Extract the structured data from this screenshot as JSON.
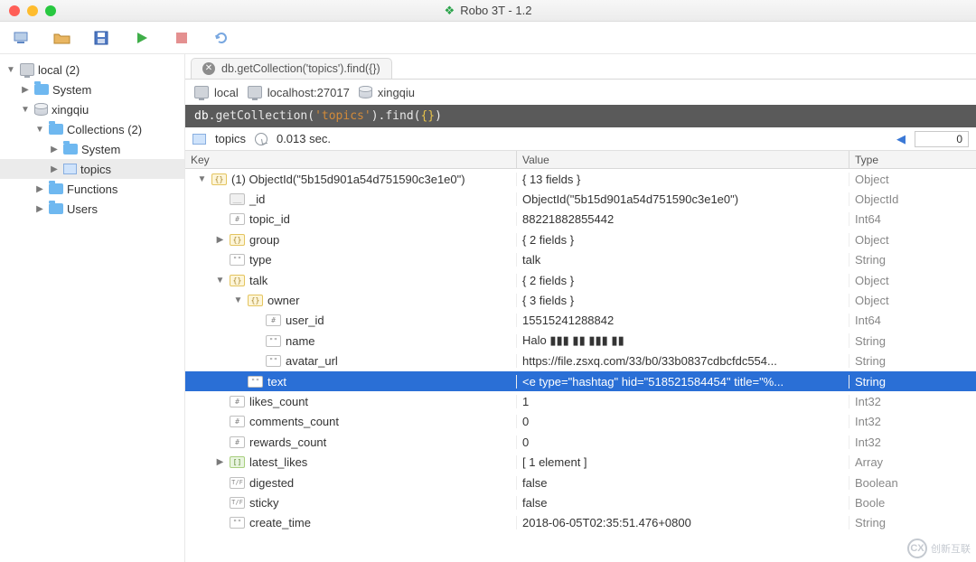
{
  "window": {
    "title": "Robo 3T - 1.2"
  },
  "toolbar_icons": [
    "connect",
    "open",
    "save",
    "run",
    "stop",
    "refresh"
  ],
  "sidebar": {
    "root": {
      "label": "local (2)",
      "expanded": true
    },
    "items": [
      {
        "label": "System",
        "expanded": false,
        "type": "folder"
      },
      {
        "label": "xingqiu",
        "expanded": true,
        "type": "db",
        "children": [
          {
            "label": "Collections (2)",
            "expanded": true,
            "type": "folder",
            "children": [
              {
                "label": "System",
                "expanded": false,
                "type": "folder"
              },
              {
                "label": "topics",
                "expanded": false,
                "type": "table",
                "selected": true
              }
            ]
          },
          {
            "label": "Functions",
            "expanded": false,
            "type": "folder"
          },
          {
            "label": "Users",
            "expanded": false,
            "type": "folder"
          }
        ]
      }
    ]
  },
  "tab": {
    "title": "db.getCollection('topics').find({})"
  },
  "breadcrumb": {
    "host": "local",
    "address": "localhost:27017",
    "db": "xingqiu"
  },
  "code": {
    "prefix": "db",
    "method1": ".getCollection(",
    "arg": "'topics'",
    "method2": ").find(",
    "braces": "{}",
    "close": ")"
  },
  "result": {
    "collection": "topics",
    "time": "0.013 sec.",
    "page": "0"
  },
  "grid": {
    "headers": {
      "key": "Key",
      "value": "Value",
      "type": "Type"
    },
    "rows": [
      {
        "depth": 0,
        "disc": "down",
        "icon": "obj",
        "iconText": "{}",
        "key": "(1) ObjectId(\"5b15d901a54d751590c3e1e0\")",
        "value": "{ 13 fields }",
        "type": "Object"
      },
      {
        "depth": 1,
        "disc": "",
        "icon": "id",
        "iconText": "__",
        "key": "_id",
        "value": "ObjectId(\"5b15d901a54d751590c3e1e0\")",
        "type": "ObjectId"
      },
      {
        "depth": 1,
        "disc": "",
        "icon": "num",
        "iconText": "#",
        "key": "topic_id",
        "value": "88221882855442",
        "type": "Int64"
      },
      {
        "depth": 1,
        "disc": "right",
        "icon": "obj",
        "iconText": "{}",
        "key": "group",
        "value": "{ 2 fields }",
        "type": "Object"
      },
      {
        "depth": 1,
        "disc": "",
        "icon": "str",
        "iconText": "\"\"",
        "key": "type",
        "value": "talk",
        "type": "String"
      },
      {
        "depth": 1,
        "disc": "down",
        "icon": "obj",
        "iconText": "{}",
        "key": "talk",
        "value": "{ 2 fields }",
        "type": "Object"
      },
      {
        "depth": 2,
        "disc": "down",
        "icon": "obj",
        "iconText": "{}",
        "key": "owner",
        "value": "{ 3 fields }",
        "type": "Object"
      },
      {
        "depth": 3,
        "disc": "",
        "icon": "num",
        "iconText": "#",
        "key": "user_id",
        "value": "15515241288842",
        "type": "Int64"
      },
      {
        "depth": 3,
        "disc": "",
        "icon": "str",
        "iconText": "\"\"",
        "key": "name",
        "value": "Halo ▮▮▮  ▮▮ ▮▮▮ ▮▮",
        "type": "String"
      },
      {
        "depth": 3,
        "disc": "",
        "icon": "str",
        "iconText": "\"\"",
        "key": "avatar_url",
        "value": "https://file.zsxq.com/33/b0/33b0837cdbcfdc554...",
        "type": "String"
      },
      {
        "depth": 2,
        "disc": "",
        "icon": "str",
        "iconText": "\"\"",
        "key": "text",
        "value": "<e type=\"hashtag\" hid=\"518521584454\" title=\"%...",
        "type": "String",
        "selected": true
      },
      {
        "depth": 1,
        "disc": "",
        "icon": "num",
        "iconText": "#",
        "key": "likes_count",
        "value": "1",
        "type": "Int32"
      },
      {
        "depth": 1,
        "disc": "",
        "icon": "num",
        "iconText": "#",
        "key": "comments_count",
        "value": "0",
        "type": "Int32"
      },
      {
        "depth": 1,
        "disc": "",
        "icon": "num",
        "iconText": "#",
        "key": "rewards_count",
        "value": "0",
        "type": "Int32"
      },
      {
        "depth": 1,
        "disc": "right",
        "icon": "arr",
        "iconText": "[]",
        "key": "latest_likes",
        "value": "[ 1 element ]",
        "type": "Array"
      },
      {
        "depth": 1,
        "disc": "",
        "icon": "bool",
        "iconText": "T/F",
        "key": "digested",
        "value": "false",
        "type": "Boolean"
      },
      {
        "depth": 1,
        "disc": "",
        "icon": "bool",
        "iconText": "T/F",
        "key": "sticky",
        "value": "false",
        "type": "Boole"
      },
      {
        "depth": 1,
        "disc": "",
        "icon": "str",
        "iconText": "\"\"",
        "key": "create_time",
        "value": "2018-06-05T02:35:51.476+0800",
        "type": "String"
      }
    ]
  },
  "watermark": "创新互联"
}
